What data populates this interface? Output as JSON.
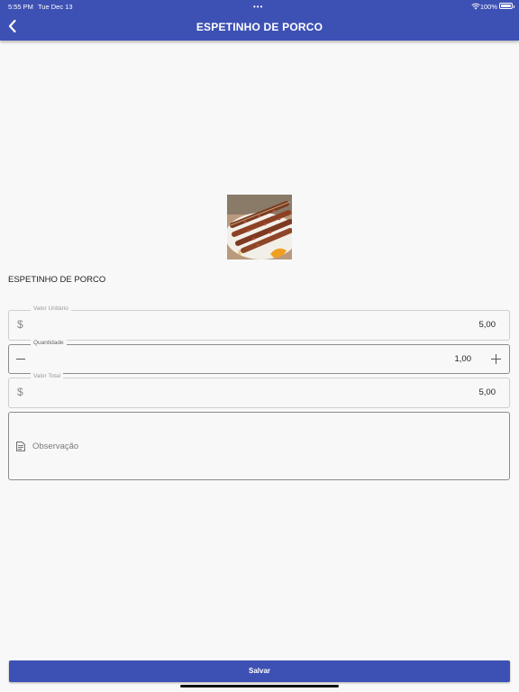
{
  "status_bar": {
    "time": "5:55 PM",
    "date": "Tue Dec 13",
    "dots": "•••",
    "battery": "100%"
  },
  "header": {
    "title": "ESPETINHO DE PORCO"
  },
  "product": {
    "name": "ESPETINHO DE PORCO"
  },
  "fields": {
    "valor_unitario": {
      "label": "Valor Unitário",
      "prefix": "$",
      "value": "5,00"
    },
    "quantidade": {
      "label": "Quantidade",
      "value": "1,00"
    },
    "valor_total": {
      "label": "Valor Total",
      "prefix": "$",
      "value": "5,00"
    },
    "observacao": {
      "placeholder": "Observação"
    }
  },
  "actions": {
    "save_label": "Salvar"
  },
  "colors": {
    "primary": "#3d51b5",
    "background": "#f8f8f8"
  },
  "icons": [
    "back-chevron-icon",
    "wifi-icon",
    "battery-icon",
    "dollar-icon",
    "minus-icon",
    "plus-icon",
    "note-icon"
  ]
}
